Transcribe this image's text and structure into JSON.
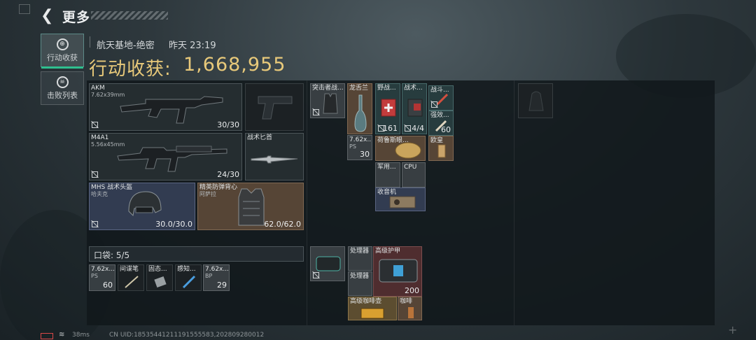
{
  "header": {
    "title": "更多"
  },
  "tabs": [
    {
      "label": "行动收获",
      "icon": "crosshair-icon"
    },
    {
      "label": "击败列表",
      "icon": "skull-icon"
    }
  ],
  "raid": {
    "map": "航天基地-绝密",
    "time": "昨天 23:19",
    "loot_label": "行动收获:",
    "loot_value": "1,668,955"
  },
  "equipment": {
    "akm": {
      "name": "AKM",
      "ammo": "7.62x39mm",
      "count": "30/30"
    },
    "m4a1": {
      "name": "M4A1",
      "ammo": "5.56x45mm",
      "count": "24/30"
    },
    "knife": {
      "name": "战术匕首"
    },
    "helmet": {
      "name": "MHS 战术头盔",
      "sub": "哈夫克",
      "durability": "30.0/30.0"
    },
    "armor": {
      "name": "精英防弹背心",
      "sub": "阿萨拉",
      "durability": "62.0/62.0"
    }
  },
  "pocket": {
    "label": "口袋:",
    "count": "5/5",
    "items": [
      {
        "name": "7.62x...",
        "sub": "PS",
        "qty": "60"
      },
      {
        "name": "间谍笔",
        "qty": ""
      },
      {
        "name": "固态...",
        "qty": ""
      },
      {
        "name": "感知...",
        "qty": ""
      },
      {
        "name": "7.62x...",
        "sub": "BP",
        "qty": "29"
      }
    ]
  },
  "rig": {
    "vest_name": "突击者战...",
    "items": [
      {
        "name": "龙舌兰"
      },
      {
        "name": "7.62x...",
        "sub": "PS",
        "qty": "30"
      },
      {
        "name": "野战...",
        "qty": "161"
      },
      {
        "name": "战术...",
        "qty": "4/4"
      },
      {
        "name": "战斗..."
      },
      {
        "name": "强效...",
        "qty": "60"
      },
      {
        "name": "荷鲁斯眼..."
      },
      {
        "name": "欧皇"
      },
      {
        "name": "军用..."
      },
      {
        "name": "CPU"
      },
      {
        "name": "收音机"
      }
    ]
  },
  "backpack": {
    "items": [
      {
        "name": "处理器"
      },
      {
        "name": "处理器"
      },
      {
        "name": "高级护甲",
        "qty": "200"
      },
      {
        "name": "高级咖啡壶"
      },
      {
        "name": "咖啡"
      }
    ]
  },
  "footer": {
    "ping": "38ms",
    "uid": "CN UID:18535441211191555583,202809280012"
  }
}
